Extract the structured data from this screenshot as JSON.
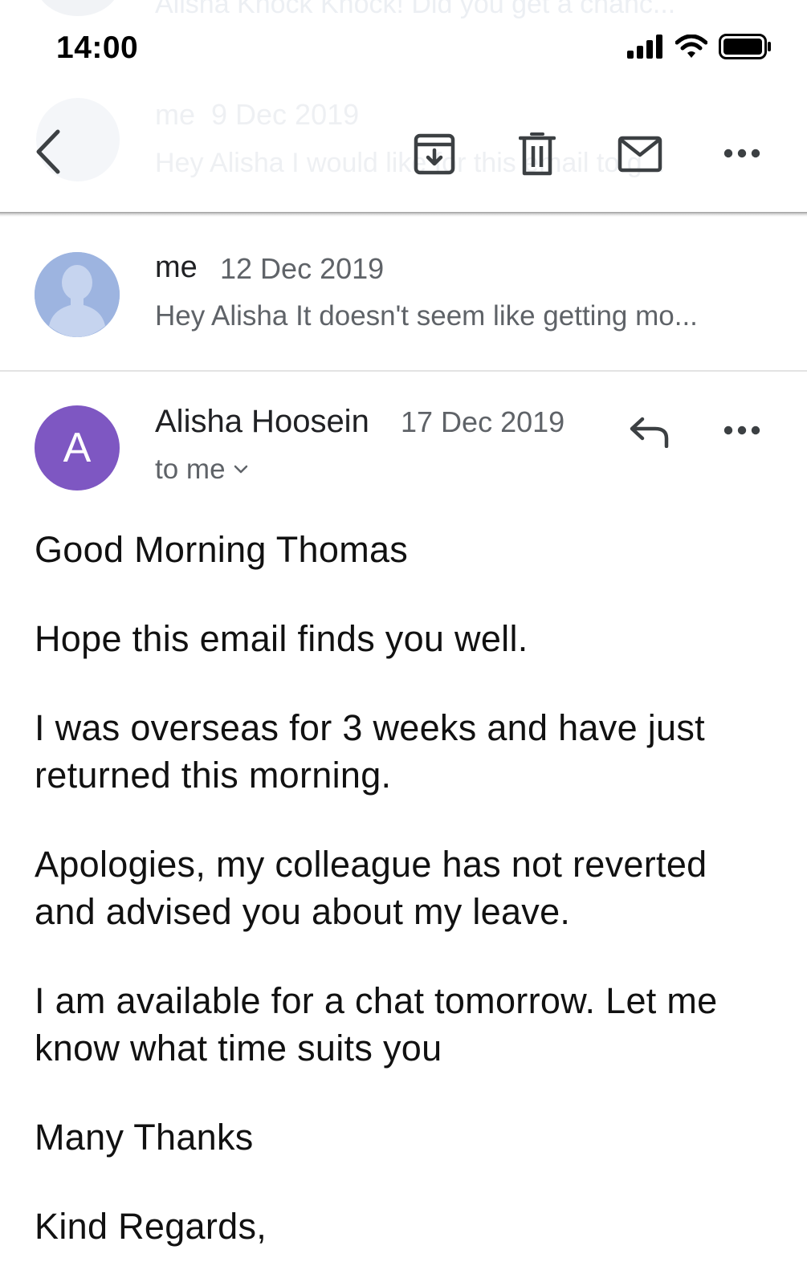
{
  "status_bar": {
    "time": "14:00"
  },
  "ghost": {
    "top_snippet": "Alisha Knock Knock! Did you get a chanc...",
    "sender": "me",
    "date": "9 Dec 2019",
    "snippet": "Hey Alisha I would like for this email to g..."
  },
  "toolbar": {
    "icons": [
      "back-icon",
      "archive-icon",
      "delete-icon",
      "mark-unread-icon",
      "more-icon"
    ]
  },
  "collapsed_message": {
    "sender": "me",
    "date": "12 Dec 2019",
    "snippet": "Hey Alisha It doesn't seem like getting mo..."
  },
  "message": {
    "avatar_letter": "A",
    "avatar_color": "#7e57c2",
    "sender": "Alisha Hoosein",
    "date": "17 Dec 2019",
    "recipient": "to me",
    "body": [
      "Good Morning Thomas",
      "Hope this email finds you well.",
      "I was overseas for 3 weeks and have just returned this morning.",
      "Apologies, my colleague has not reverted and advised you about my leave.",
      "I am available for a chat tomorrow. Let me know what time suits you",
      "Many Thanks",
      "Kind Regards,"
    ]
  }
}
